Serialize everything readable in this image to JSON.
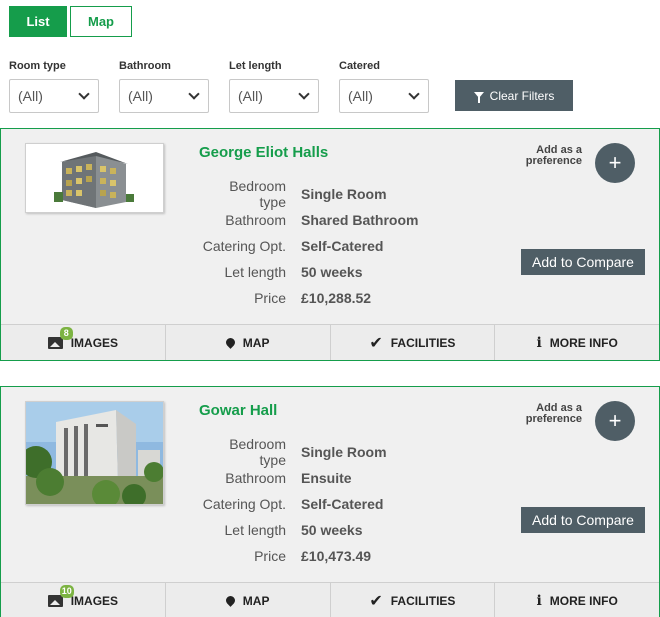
{
  "view_toggle": {
    "list": "List",
    "map": "Map"
  },
  "filters": [
    {
      "label": "Room type",
      "value": "(All)"
    },
    {
      "label": "Bathroom",
      "value": "(All)"
    },
    {
      "label": "Let length",
      "value": "(All)"
    },
    {
      "label": "Catered",
      "value": "(All)"
    }
  ],
  "clear_filters": "Clear Filters",
  "field_labels": {
    "bedroom": "Bedroom type",
    "bathroom": "Bathroom",
    "catering": "Catering Opt.",
    "let_length": "Let length",
    "price": "Price"
  },
  "preference_label": "Add as a preference",
  "compare_label": "Add to Compare",
  "tabs": {
    "images": "IMAGES",
    "map": "MAP",
    "facilities": "FACILITIES",
    "more_info": "MORE INFO"
  },
  "halls": [
    {
      "name": "George Eliot Halls",
      "bedroom": "Single Room",
      "bathroom": "Shared Bathroom",
      "catering": "Self-Catered",
      "let_length": "50 weeks",
      "price": "£10,288.52",
      "image_count": "8"
    },
    {
      "name": "Gowar Hall",
      "bedroom": "Single Room",
      "bathroom": "Ensuite",
      "catering": "Self-Catered",
      "let_length": "50 weeks",
      "price": "£10,473.49",
      "image_count": "10"
    }
  ],
  "colors": {
    "brand_green": "#159d4b",
    "button_slate": "#4f5e66",
    "badge_green": "#7cb342"
  }
}
